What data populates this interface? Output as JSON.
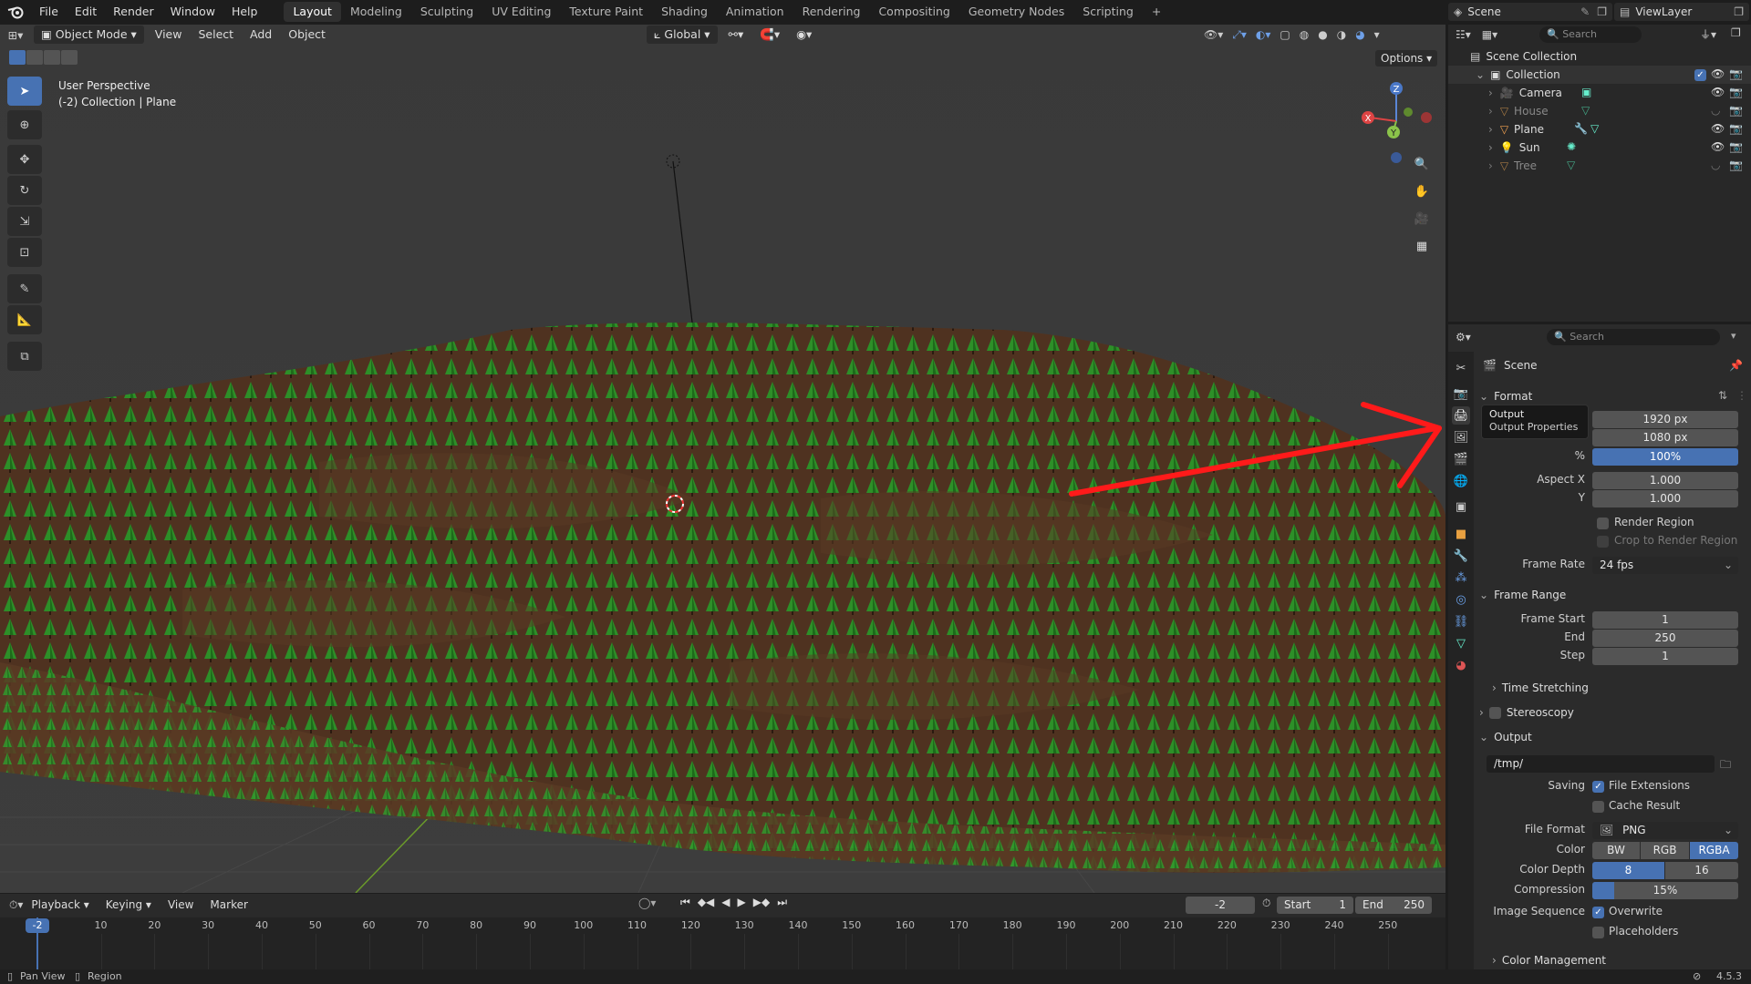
{
  "topbar": {
    "menus": [
      "File",
      "Edit",
      "Render",
      "Window",
      "Help"
    ],
    "workspaces": [
      "Layout",
      "Modeling",
      "Sculpting",
      "UV Editing",
      "Texture Paint",
      "Shading",
      "Animation",
      "Rendering",
      "Compositing",
      "Geometry Nodes",
      "Scripting"
    ],
    "active_workspace": "Layout",
    "add_workspace": "+",
    "scene": "Scene",
    "view_layer": "ViewLayer"
  },
  "viewport": {
    "mode": "Object Mode",
    "menus": [
      "View",
      "Select",
      "Add",
      "Object"
    ],
    "orientation": "Global",
    "options": "Options",
    "info_line1": "User Perspective",
    "info_line2": "(-2) Collection | Plane",
    "gizmo": {
      "x": "X",
      "y": "Y",
      "z": "Z"
    }
  },
  "outliner": {
    "search_placeholder": "Search",
    "scene_collection": "Scene Collection",
    "collection": "Collection",
    "items": [
      {
        "name": "Camera",
        "visible": true
      },
      {
        "name": "House",
        "visible": false
      },
      {
        "name": "Plane",
        "visible": true
      },
      {
        "name": "Sun",
        "visible": true
      },
      {
        "name": "Tree",
        "visible": false
      }
    ]
  },
  "properties": {
    "search_placeholder": "Search",
    "context": "Scene",
    "tooltip": {
      "title": "Output",
      "subtitle": "Output Properties"
    },
    "format": {
      "header": "Format",
      "res_x": "1920 px",
      "res_y": "1080 px",
      "percent_label": "%",
      "percent": "100%",
      "aspect_x_label": "Aspect X",
      "aspect_x": "1.000",
      "aspect_y_label": "Y",
      "aspect_y": "1.000",
      "render_region": "Render Region",
      "crop": "Crop to Render Region",
      "frame_rate_label": "Frame Rate",
      "frame_rate": "24 fps"
    },
    "frame_range": {
      "header": "Frame Range",
      "start_label": "Frame Start",
      "start": "1",
      "end_label": "End",
      "end": "250",
      "step_label": "Step",
      "step": "1",
      "time_stretching": "Time Stretching"
    },
    "stereoscopy": "Stereoscopy",
    "output": {
      "header": "Output",
      "path": "/tmp/",
      "saving_label": "Saving",
      "file_extensions": "File Extensions",
      "cache_result": "Cache Result",
      "file_format_label": "File Format",
      "file_format": "PNG",
      "color_label": "Color",
      "color_options": [
        "BW",
        "RGB",
        "RGBA"
      ],
      "color_selected": "RGBA",
      "depth_label": "Color Depth",
      "depth_options": [
        "8",
        "16"
      ],
      "depth_selected": "8",
      "compression_label": "Compression",
      "compression": "15%",
      "compression_value": 0.15,
      "image_sequence_label": "Image Sequence",
      "overwrite": "Overwrite",
      "placeholders": "Placeholders",
      "color_management": "Color Management"
    }
  },
  "timeline": {
    "menus": [
      "Playback",
      "Keying",
      "View",
      "Marker"
    ],
    "current_frame": "-2",
    "current_marker": "-2",
    "start_label": "Start",
    "start": "1",
    "end_label": "End",
    "end": "250",
    "ticks": [
      "10",
      "20",
      "30",
      "40",
      "50",
      "60",
      "70",
      "80",
      "90",
      "100",
      "110",
      "120",
      "130",
      "140",
      "150",
      "160",
      "170",
      "180",
      "190",
      "200",
      "210",
      "220",
      "230",
      "240",
      "250"
    ]
  },
  "statusbar": {
    "pan": "Pan View",
    "region": "Region",
    "version": "4.5.3"
  },
  "colors": {
    "accent": "#4772b3",
    "annotation_arrow": "#ff1a1a",
    "ground": "#5a3a22",
    "trees": "#2f8a2a"
  }
}
